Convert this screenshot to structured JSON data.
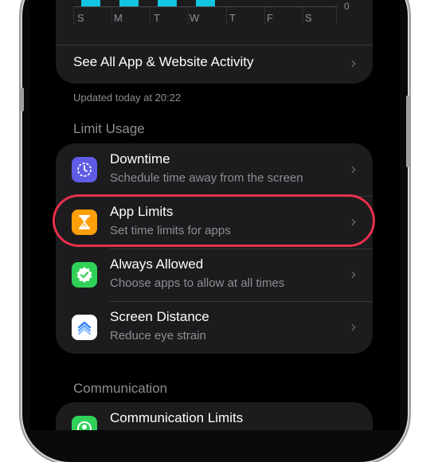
{
  "chart": {
    "days": [
      "S",
      "M",
      "T",
      "W",
      "T",
      "F",
      "S"
    ],
    "zero_label": "0",
    "bar_color": "#12c5e0",
    "see_all_label": "See All App & Website Activity"
  },
  "updated_text": "Updated today at 20:22",
  "limit_usage": {
    "section_title": "Limit Usage",
    "items": [
      {
        "title": "Downtime",
        "subtitle": "Schedule time away from the screen",
        "icon": "downtime-icon",
        "color": "#5e5ce6"
      },
      {
        "title": "App Limits",
        "subtitle": "Set time limits for apps",
        "icon": "hourglass-icon",
        "color": "#ff9f0a"
      },
      {
        "title": "Always Allowed",
        "subtitle": "Choose apps to allow at all times",
        "icon": "checkmark-seal-icon",
        "color": "#30d158"
      },
      {
        "title": "Screen Distance",
        "subtitle": "Reduce eye strain",
        "icon": "screen-distance-icon",
        "color": "#ffffff"
      }
    ]
  },
  "communication": {
    "section_title": "Communication",
    "items": [
      {
        "title": "Communication Limits",
        "icon": "communication-icon",
        "color": "#30d158"
      }
    ]
  },
  "highlight_color": "#e8304c"
}
